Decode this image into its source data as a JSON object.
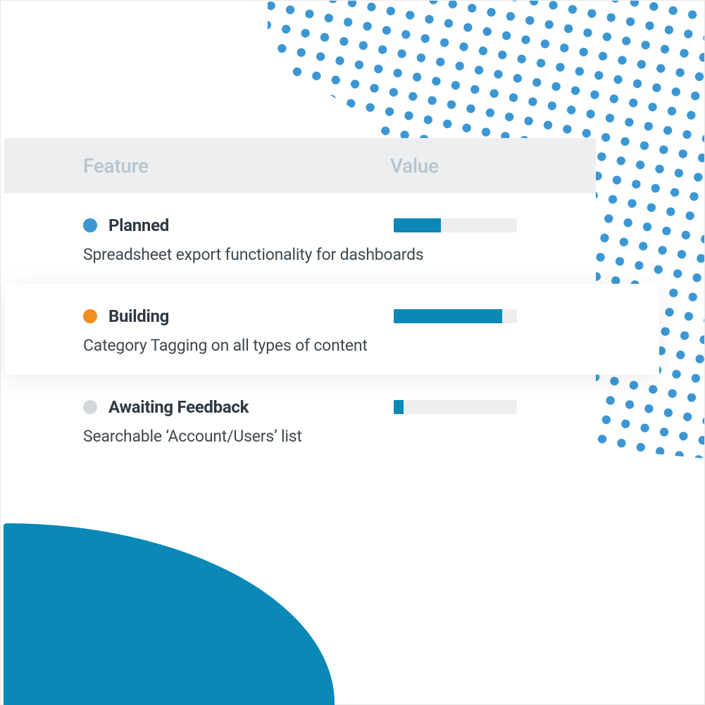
{
  "colors": {
    "accent": "#0a89b6",
    "dot_pattern": "#3b97d3",
    "status_planned": "#3b97d3",
    "status_building": "#f28d1e",
    "status_awaiting": "#d3d8dc",
    "bar_track": "#eceeef",
    "bar_fill": "#0a89b6"
  },
  "header": {
    "feature": "Feature",
    "value": "Value"
  },
  "rows": [
    {
      "status_label": "Planned",
      "status_color": "#3b97d3",
      "description": "Spreadsheet export functionality for dashboards",
      "value_percent": 38,
      "raised": false
    },
    {
      "status_label": "Building",
      "status_color": "#f28d1e",
      "description": "Category Tagging on all types of content",
      "value_percent": 88,
      "raised": true
    },
    {
      "status_label": "Awaiting Feedback",
      "status_color": "#d3d8dc",
      "description": "Searchable ‘Account/Users’ list",
      "value_percent": 8,
      "raised": false
    }
  ]
}
